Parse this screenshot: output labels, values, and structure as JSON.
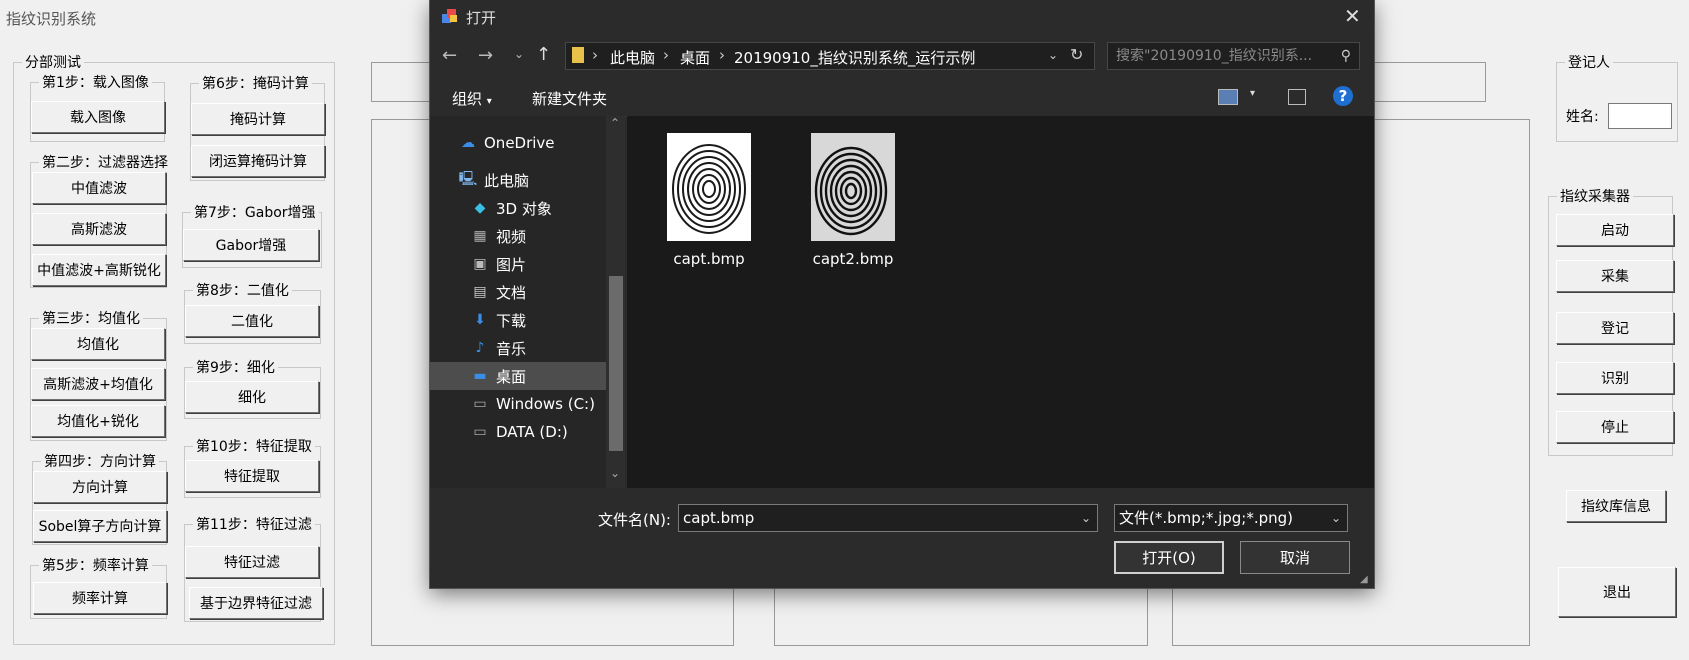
{
  "app": {
    "title": "指纹识别系统"
  },
  "steps": {
    "group_title": "分部测试",
    "s1": {
      "title": "第1步：载入图像",
      "btn": "载入图像"
    },
    "s2": {
      "title": "第二步：过滤器选择",
      "btns": [
        "中值滤波",
        "高斯滤波",
        "中值滤波+高斯锐化"
      ]
    },
    "s3": {
      "title": "第三步：均值化",
      "btns": [
        "均值化",
        "高斯滤波+均值化",
        "均值化+锐化"
      ]
    },
    "s4": {
      "title": "第四步：方向计算",
      "btns": [
        "方向计算",
        "Sobel算子方向计算"
      ]
    },
    "s5": {
      "title": "第5步：频率计算",
      "btn": "频率计算"
    },
    "s6": {
      "title": "第6步：掩码计算",
      "btns": [
        "掩码计算",
        "闭运算掩码计算"
      ]
    },
    "s7": {
      "title": "第7步：Gabor增强",
      "btn": "Gabor增强"
    },
    "s8": {
      "title": "第8步：二值化",
      "btn": "二值化"
    },
    "s9": {
      "title": "第9步：细化",
      "btn": "细化"
    },
    "s10": {
      "title": "第10步：特征提取",
      "btn": "特征提取"
    },
    "s11": {
      "title": "第11步：特征过滤",
      "btns": [
        "特征过滤",
        "基于边界特征过滤"
      ]
    }
  },
  "register": {
    "title": "登记人",
    "name_label": "姓名:",
    "name_value": ""
  },
  "collector": {
    "title": "指纹采集器",
    "btns": [
      "启动",
      "采集",
      "登记",
      "识别",
      "停止"
    ]
  },
  "db_info_btn": "指纹库信息",
  "exit_btn": "退出",
  "dialog": {
    "title": "打开",
    "address": {
      "segments": [
        "此电脑",
        "桌面",
        "20190910_指纹识别系统_运行示例"
      ]
    },
    "search_placeholder": "搜索\"20190910_指纹识别系...",
    "organize": "组织",
    "new_folder": "新建文件夹",
    "nav": [
      {
        "label": "OneDrive",
        "icon": "cloud-icon"
      },
      {
        "label": "此电脑",
        "icon": "computer-icon"
      },
      {
        "label": "3D 对象",
        "icon": "cube-icon"
      },
      {
        "label": "视频",
        "icon": "video-icon"
      },
      {
        "label": "图片",
        "icon": "picture-icon"
      },
      {
        "label": "文档",
        "icon": "document-icon"
      },
      {
        "label": "下载",
        "icon": "download-icon"
      },
      {
        "label": "音乐",
        "icon": "music-icon"
      },
      {
        "label": "桌面",
        "icon": "desktop-icon",
        "selected": true
      },
      {
        "label": "Windows (C:)",
        "icon": "drive-icon"
      },
      {
        "label": "DATA (D:)",
        "icon": "drive-icon"
      }
    ],
    "files": [
      {
        "name": "capt.bmp"
      },
      {
        "name": "capt2.bmp"
      }
    ],
    "filename_label": "文件名(N):",
    "filename_value": "capt.bmp",
    "filetype": "文件(*.bmp;*.jpg;*.png)",
    "open_btn": "打开(O)",
    "cancel_btn": "取消"
  }
}
